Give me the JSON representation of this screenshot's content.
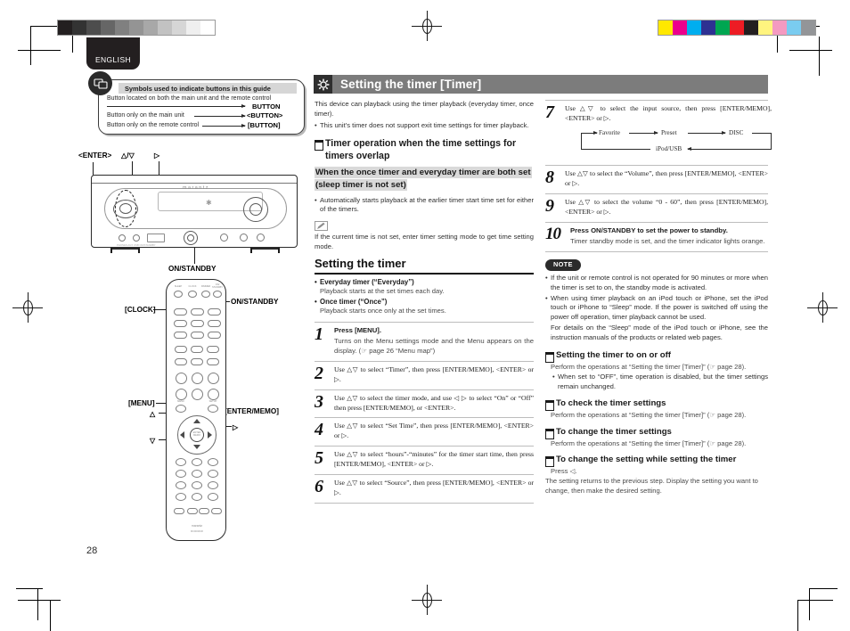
{
  "meta": {
    "page_number": "28",
    "language_tab": "ENGLISH"
  },
  "colors": {
    "header_bar": "#7c7c7c",
    "header_icon_box": "#2f2f2f",
    "highlight": "#d9d9d9",
    "note_badge": "#2b2b2b",
    "text": "#2f2f2f"
  },
  "calibration": {
    "grayscale": [
      "#231f20",
      "#333333",
      "#4d4d4d",
      "#666666",
      "#808080",
      "#949494",
      "#a8a8a8",
      "#c2c2c2",
      "#d6d6d6",
      "#efefef",
      "#ffffff"
    ],
    "colorbar": [
      "#ffe800",
      "#ec008c",
      "#00aeef",
      "#2e3192",
      "#00a651",
      "#ed1c24",
      "#231f20",
      "#fff47f",
      "#f49ac1",
      "#7accf0",
      "#939598"
    ]
  },
  "symbols_box": {
    "badge": "symbol-badge",
    "title": "Symbols used to indicate buttons in this guide",
    "rows": [
      {
        "label": "Button located on both the main unit and the remote control",
        "key": "BUTTON"
      },
      {
        "label": "Button only on the main unit",
        "key": "<BUTTON>"
      },
      {
        "label": "Button only on the remote control",
        "key": "[BUTTON]"
      }
    ]
  },
  "illustrations": {
    "main_unit": {
      "brand": "marantz",
      "labels": [
        "<ENTER>",
        "△/▽",
        "▷",
        "ON/STANDBY"
      ]
    },
    "remote": {
      "brand": "marantz",
      "model": "RC003CR",
      "labels": [
        "[CLOCK]",
        "ON/STANDBY",
        "[MENU]",
        "[ENTER/MEMO]",
        "△",
        "▽",
        "▷"
      ]
    }
  },
  "section": {
    "icon": "timer-gear-icon",
    "title": "Setting the timer [Timer]",
    "intro": "This device can playback using the timer playback (everyday timer, once timer).",
    "intro_bullet": "This unit’s timer does not support exit time settings for timer playback.",
    "overlap_heading": "Timer operation when the time settings for timers overlap",
    "overlap_subheading": "When the once timer and everyday timer are both set (sleep timer is not set)",
    "overlap_bullet": "Automatically starts playback at the earlier timer start time set for either of the timers.",
    "memo_icon": "pencil-memo-icon",
    "memo_text": "If the current time is not set, enter timer setting mode to get time setting mode."
  },
  "setting_timer": {
    "heading": "Setting the timer",
    "definitions": [
      {
        "term": "Everyday timer (“Everyday”)",
        "desc": "Playback starts at the set times each day."
      },
      {
        "term": "Once timer (“Once”)",
        "desc": "Playback starts once only at the set times."
      }
    ],
    "steps": [
      {
        "num": "1",
        "text": "Press [MENU].",
        "bold_lead": true,
        "note": "Turns on the Menu settings mode and the Menu appears on the display. (☞ page 26 “Menu map”)"
      },
      {
        "num": "2",
        "text": "Use △▽ to select “Timer”, then press [ENTER/MEMO], <ENTER> or ▷."
      },
      {
        "num": "3",
        "text": "Use △▽ to select the timer mode, and use ◁ ▷ to select “On” or “Off” then press [ENTER/MEMO], or <ENTER>."
      },
      {
        "num": "4",
        "text": "Use △▽ to select “Set Time”, then press [ENTER/MEMO], <ENTER> or ▷."
      },
      {
        "num": "5",
        "text": "Use △▽ to select “hours”-“minutes” for the timer start time, then press [ENTER/MEMO], <ENTER> or ▷."
      },
      {
        "num": "6",
        "text": "Use △▽ to select “Source”, then press [ENTER/MEMO], <ENTER> or ▷."
      },
      {
        "num": "7",
        "text": "Use △▽ to select the input source, then press [ENTER/MEMO], <ENTER> or ▷."
      },
      {
        "num": "8",
        "text": "Use △▽ to select the “Volume”, then press [ENTER/MEMO], <ENTER> or ▷."
      },
      {
        "num": "9",
        "text": "Use △▽ to select the volume “0 - 60”, then press [ENTER/MEMO], <ENTER> or ▷."
      },
      {
        "num": "10",
        "text": "Press ON/STANDBY to set the power to standby.",
        "bold_lead": true,
        "note": "Timer standby mode is set, and the timer indicator lights orange."
      }
    ]
  },
  "source_flow": {
    "items": [
      "Favorite",
      "Preset",
      "DISC",
      "iPod/USB"
    ]
  },
  "note_block": {
    "badge": "NOTE",
    "bullets": [
      "If the unit or remote control is not operated for 90 minutes or more when the timer is set to on, the standby mode is activated.",
      "When using timer playback on an iPod touch or iPhone, set the iPod touch or iPhone to “Sleep” mode. If the power is switched off using the power off operation, timer playback cannot be used."
    ],
    "extra": "For details on the “Sleep” mode of the iPod touch or iPhone, see the instruction manuals of the products or related web pages."
  },
  "subsections": [
    {
      "heading": "Setting the timer to on or off",
      "body": "Perform the operations at “Setting the timer [Timer]” (☞ page 28).",
      "bullet": "When set to “OFF”, time operation is disabled, but the timer settings remain unchanged."
    },
    {
      "heading": "To check the timer settings",
      "body": "Perform the operations at “Setting the timer [Timer]” (☞ page 28)."
    },
    {
      "heading": "To change the timer settings",
      "body": "Perform the operations at “Setting the timer [Timer]” (☞ page 28)."
    },
    {
      "heading": "To change the setting while setting the timer",
      "body": "Press ◁.",
      "body2": "The setting returns to the previous step. Display the setting you want to change, then make the desired setting."
    }
  ]
}
